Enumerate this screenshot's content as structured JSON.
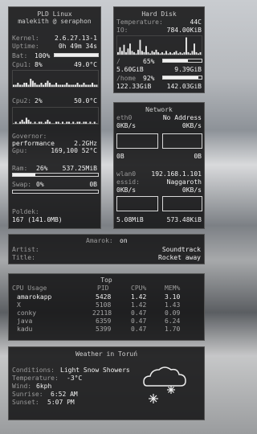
{
  "system": {
    "header_line1": "PLD Linux",
    "header_line2": "malekith @ seraphon",
    "kernel_label": "Kernel:",
    "kernel_value": "2.6.27.13-1",
    "uptime_label": "Uptime:",
    "uptime_value": "0h 49m 34s",
    "bat_label": "Bat:",
    "bat_value": "100%",
    "bat_fraction": 1.0,
    "cpu1_label": "Cpu1:",
    "cpu1_value": "8%",
    "cpu1_temp": "49.0°C",
    "cpu1_graph": [
      1,
      1,
      2,
      1,
      1,
      2,
      2,
      1,
      4,
      3,
      2,
      1,
      1,
      2,
      1,
      2,
      3,
      2,
      1,
      1,
      2,
      1,
      1,
      1,
      1,
      2,
      1,
      1,
      1,
      1,
      2,
      1,
      1,
      2,
      1,
      1,
      1,
      2,
      1,
      1
    ],
    "cpu2_label": "Cpu2:",
    "cpu2_value": "2%",
    "cpu2_temp": "50.0°C",
    "cpu2_graph": [
      0,
      1,
      0,
      1,
      2,
      1,
      3,
      2,
      1,
      0,
      1,
      0,
      1,
      1,
      0,
      1,
      2,
      1,
      0,
      0,
      1,
      1,
      0,
      1,
      0,
      1,
      1,
      0,
      1,
      0,
      1,
      1,
      0,
      1,
      1,
      0,
      1,
      0,
      1,
      0
    ],
    "governor_label": "Governor:",
    "governor_value": "performance",
    "governor_freq": "2.2GHz",
    "gpu_label": "Gpu:",
    "gpu_value": "169,100 52°C",
    "ram_label": "Ram:",
    "ram_value": "26%",
    "ram_amount": "537.25MiB",
    "ram_fraction": 0.26,
    "swap_label": "Swap:",
    "swap_value": "0%",
    "swap_amount": "0B",
    "swap_fraction": 0.0,
    "poldek_label": "Poldek:",
    "poldek_value": "167 (141.0MB)"
  },
  "disk": {
    "header": "Hard Disk",
    "temp_label": "Temperature:",
    "temp_value": "44C",
    "io_label": "IO:",
    "io_value": "784.00KiB",
    "io_graph": [
      2,
      6,
      3,
      8,
      2,
      5,
      9,
      3,
      2,
      1,
      4,
      12,
      3,
      2,
      7,
      2,
      1,
      3,
      2,
      4,
      2,
      1,
      2,
      1,
      3,
      1,
      2,
      1,
      2,
      3,
      1,
      2,
      1,
      2,
      14,
      2,
      1,
      3,
      9,
      2,
      1,
      2
    ],
    "root_label": "/",
    "root_pct": "65%",
    "root_fraction": 0.65,
    "root_used": "5.60GiB",
    "root_total": "9.39GiB",
    "home_label": "/home",
    "home_pct": "92%",
    "home_fraction": 0.92,
    "home_used": "122.33GiB",
    "home_total": "142.03GiB"
  },
  "network": {
    "header": "Network",
    "eth0_label": "eth0",
    "eth0_address": "No Address",
    "eth0_down": "0KB/s",
    "eth0_up": "0KB/s",
    "eth0_total_down": "0B",
    "eth0_total_up": "0B",
    "wlan0_label": "wlan0",
    "wlan0_address": "192.168.1.101",
    "essid_label": "essid:",
    "essid_value": "Naggaroth",
    "wlan0_down": "0KB/s",
    "wlan0_up": "0KB/s",
    "wlan0_total_down": "5.08MiB",
    "wlan0_total_up": "573.48KiB"
  },
  "amarok": {
    "header_label": "Amarok:",
    "status": "on",
    "artist_label": "Artist:",
    "artist_value": "Soundtrack",
    "title_label": "Title:",
    "title_value": "Rocket away"
  },
  "top": {
    "header": "Top",
    "subheader": "CPU Usage",
    "columns": [
      "PID",
      "CPU%",
      "MEM%"
    ],
    "rows": [
      {
        "name": "amarokapp",
        "pid": "5428",
        "cpu": "1.42",
        "mem": "3.10"
      },
      {
        "name": "X",
        "pid": "5108",
        "cpu": "1.42",
        "mem": "1.43"
      },
      {
        "name": "conky",
        "pid": "22118",
        "cpu": "0.47",
        "mem": "0.09"
      },
      {
        "name": "java",
        "pid": "6359",
        "cpu": "0.47",
        "mem": "6.24"
      },
      {
        "name": "kadu",
        "pid": "5399",
        "cpu": "0.47",
        "mem": "1.70"
      }
    ]
  },
  "weather": {
    "header": "Weather in Toruń",
    "conditions_label": "Conditions:",
    "conditions_value": "Light Snow Showers",
    "temperature_label": "Temperature:",
    "temperature_value": "-3°C",
    "wind_label": "Wind:",
    "wind_value": "6kph",
    "sunrise_label": "Sunrise:",
    "sunrise_value": "6:52 AM",
    "sunset_label": "Sunset:",
    "sunset_value": "5:07 PM",
    "icon": "snow-cloud-icon"
  }
}
